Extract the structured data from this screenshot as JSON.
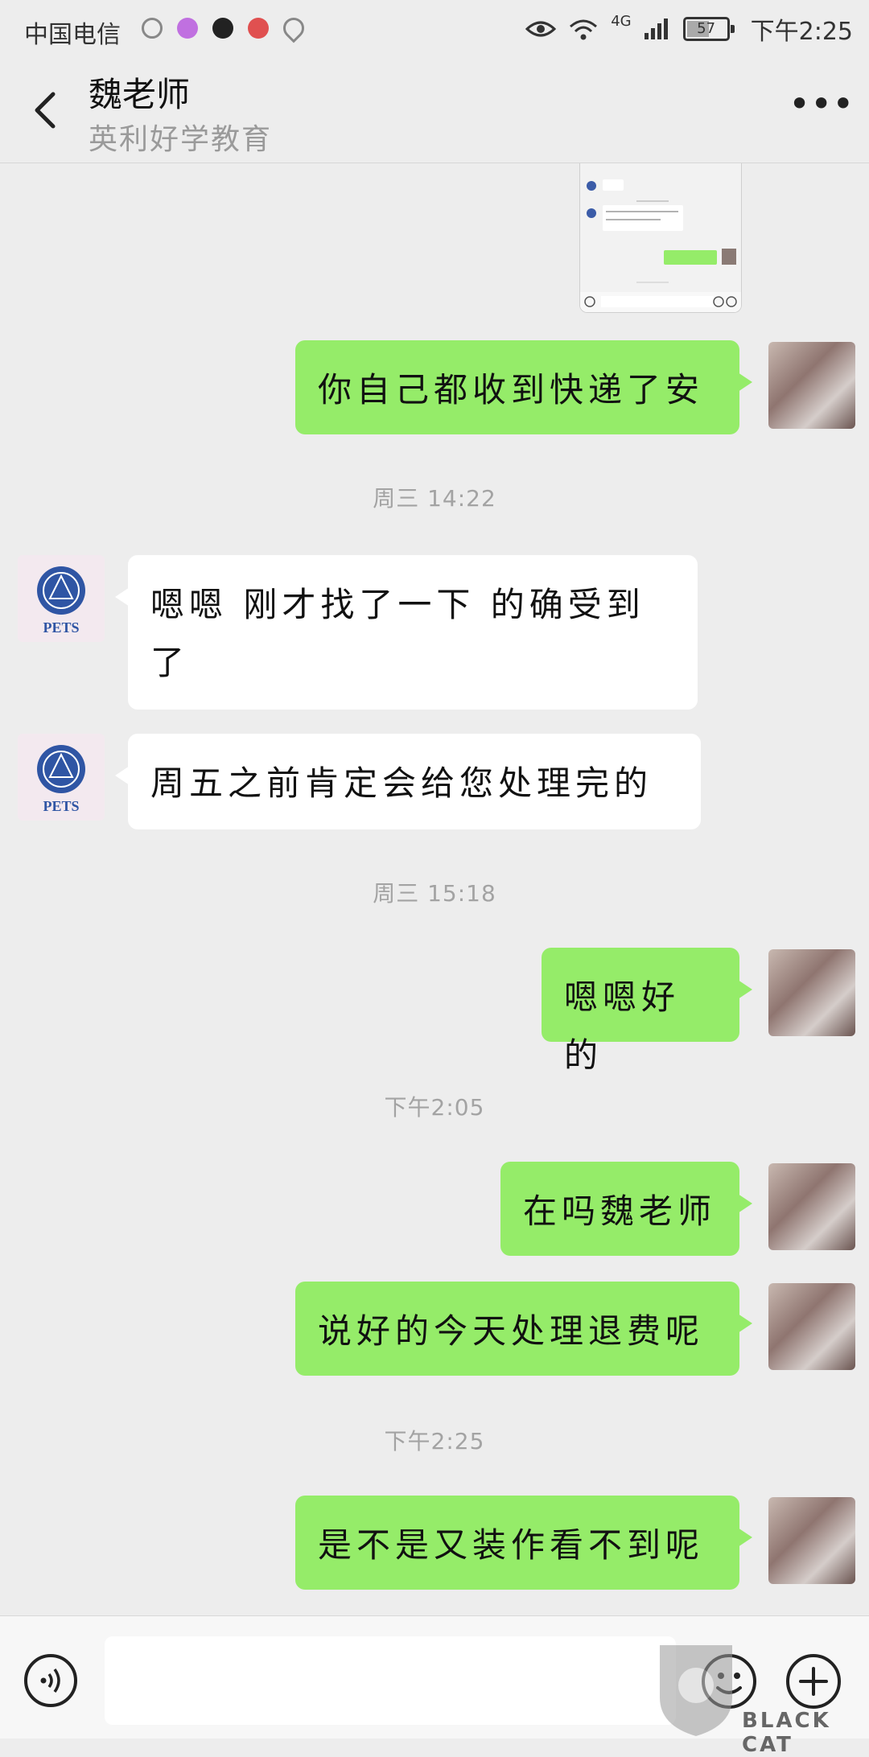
{
  "status_bar": {
    "carrier": "中国电信",
    "network": "4G",
    "battery": "57",
    "battery_level": 0.57,
    "time": "下午2:25"
  },
  "header": {
    "title": "魏老师",
    "subtitle": "英利好学教育",
    "back_icon": "chevron-left-icon",
    "more_icon": "more-dots-icon"
  },
  "messages": [
    {
      "type": "image",
      "from": "me"
    },
    {
      "type": "text",
      "from": "me",
      "text": "你自己都收到快递了安"
    },
    {
      "type": "time",
      "text": "周三 14:22"
    },
    {
      "type": "text",
      "from": "teacher",
      "text": "嗯嗯  刚才找了一下 的确受到了"
    },
    {
      "type": "text",
      "from": "teacher",
      "text": "周五之前肯定会给您处理完的"
    },
    {
      "type": "time",
      "text": "周三 15:18"
    },
    {
      "type": "text",
      "from": "me",
      "text": "嗯嗯好的"
    },
    {
      "type": "time",
      "text": "下午2:05"
    },
    {
      "type": "text",
      "from": "me",
      "text": "在吗魏老师"
    },
    {
      "type": "text",
      "from": "me",
      "text": "说好的今天处理退费呢"
    },
    {
      "type": "time",
      "text": "下午2:25"
    },
    {
      "type": "text",
      "from": "me",
      "text": "是不是又装作看不到呢"
    }
  ],
  "teacher_avatar_label": "PETS",
  "input": {
    "value": "",
    "voice_icon": "voice-icon",
    "emoji_icon": "emoji-icon",
    "plus_icon": "plus-icon"
  },
  "watermark": "BLACK CAT",
  "colors": {
    "background": "#ededed",
    "outgoing_bubble": "#95ec69",
    "incoming_bubble": "#ffffff",
    "timestamp": "#a3a3a3"
  }
}
